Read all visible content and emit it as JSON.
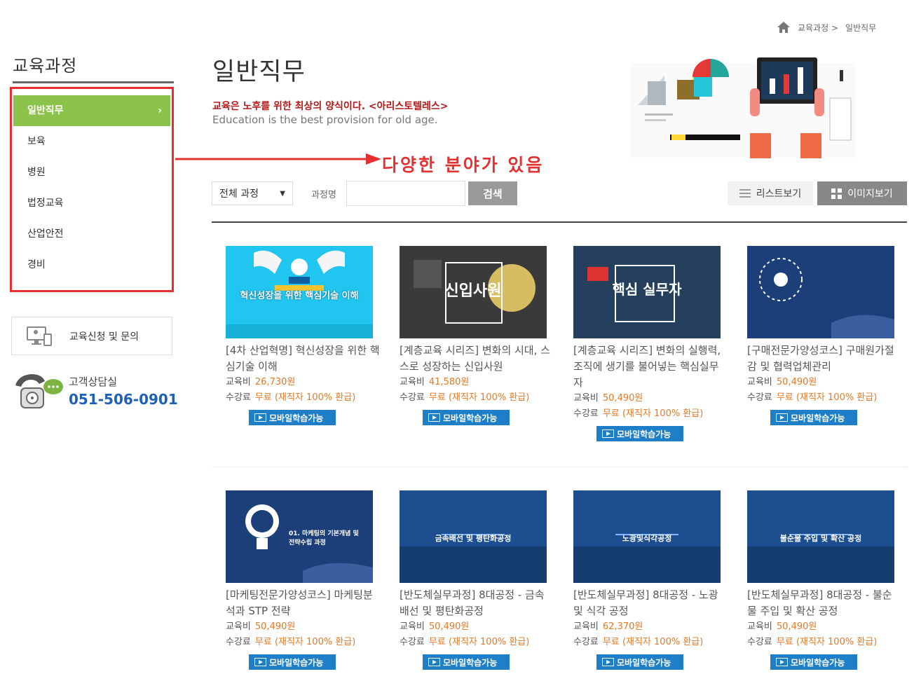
{
  "breadcrumb": {
    "items": [
      "교육과정 >",
      "일반직무"
    ]
  },
  "sidebar": {
    "title": "교육과정",
    "items": [
      {
        "label": "일반직무",
        "active": true
      },
      {
        "label": "보육"
      },
      {
        "label": "병원"
      },
      {
        "label": "법정교육"
      },
      {
        "label": "산업안전"
      },
      {
        "label": "경비"
      }
    ],
    "apply_label": "교육신청 및 문의",
    "support_label": "고객상담실",
    "support_phone": "051-506-0901"
  },
  "annotation": {
    "text": "다양한 분야가 있음",
    "color": "#e53030"
  },
  "header": {
    "title": "일반직무",
    "quote_ko": "교육은 노후를 위한 최상의 양식이다. <아리스토텔레스>",
    "quote_en": "Education is the best provision for old age."
  },
  "search": {
    "select_value": "전체 과정",
    "field_label": "과정명",
    "button_label": "검색",
    "list_view_label": "리스트보기",
    "image_view_label": "이미지보기"
  },
  "labels": {
    "fee": "교육비",
    "tuition": "수강료",
    "mobile": "모바일학습가능"
  },
  "courses": [
    {
      "title": "[4차 산업혁명] 혁신성장을 위한 핵심기술 이해",
      "fee": "26,730원",
      "tuition": "무료 (재직자 100% 환급)",
      "thumb_text": "혁신성장을 위한 핵심기술 이해"
    },
    {
      "title": "[계층교육 시리즈] 변화의 시대, 스스로 성장하는 신입사원",
      "fee": "41,580원",
      "tuition": "무료 (재직자 100% 환급)",
      "thumb_text": "신입사원"
    },
    {
      "title": "[계층교육 시리즈] 변화의 실행력, 조직에 생기를 불어넣는 핵심실무자",
      "fee": "50,490원",
      "tuition": "무료 (재직자 100% 환급)",
      "thumb_text": "핵심 실무자"
    },
    {
      "title": "[구매전문가양성코스] 구매원가절감 및 협력업체관리",
      "fee": "50,490원",
      "tuition": "무료 (재직자 100% 환급)",
      "thumb_text": ""
    },
    {
      "title": "[마케팅전문가양성코스] 마케팅분석과 STP 전략",
      "fee": "50,490원",
      "tuition": "무료 (재직자 100% 환급)",
      "thumb_text": "01. 마케팅의 기본개념 및 전략수립 과정"
    },
    {
      "title": "[반도체실무과정] 8대공정 - 금속배선 및 평탄화공정",
      "fee": "50,490원",
      "tuition": "무료 (재직자 100% 환급)",
      "thumb_text": "금속배선 및 평탄화공정"
    },
    {
      "title": "[반도체실무과정] 8대공정 - 노광 및 식각 공정",
      "fee": "62,370원",
      "tuition": "무료 (재직자 100% 환급)",
      "thumb_text": "노광및식각공정"
    },
    {
      "title": "[반도체실무과정] 8대공정 - 불순물 주입 및 확산 공정",
      "fee": "50,490원",
      "tuition": "무료 (재직자 100% 환급)",
      "thumb_text": "불순물 주입 및 확산 공정"
    }
  ]
}
